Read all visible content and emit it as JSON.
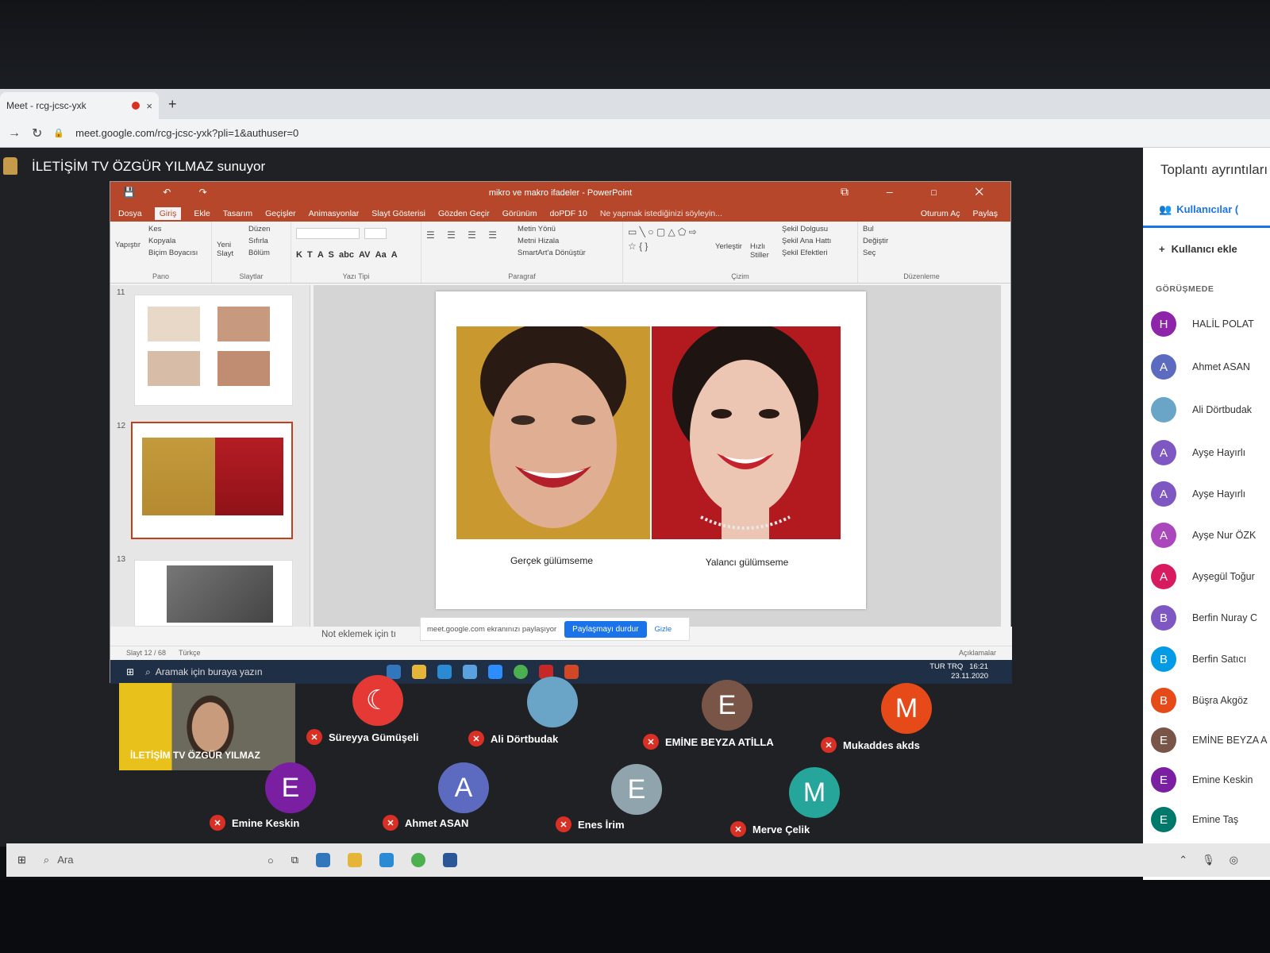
{
  "browser": {
    "tab_title": "Meet - rcg-jcsc-yxk",
    "tab_close": "×",
    "new_tab": "+",
    "url": "meet.google.com/rcg-jcsc-yxk?pli=1&authuser=0"
  },
  "meet": {
    "presenter_banner": "İLETİŞİM TV ÖZGÜR YILMAZ sunuyor",
    "share_notice": "meet.google.com ekranınızı paylaşıyor",
    "stop_sharing": "Paylaşmayı durdur",
    "hide": "Gizle"
  },
  "powerpoint": {
    "doc_title": "mikro ve makro ifadeler - PowerPoint",
    "menu": [
      "Dosya",
      "Giriş",
      "Ekle",
      "Tasarım",
      "Geçişler",
      "Animasyonlar",
      "Slayt Gösterisi",
      "Gözden Geçir",
      "Görünüm",
      "doPDF 10"
    ],
    "tell_me": "Ne yapmak istediğinizi söyleyin...",
    "sign_in": "Oturum Aç",
    "share": "Paylaş",
    "ribbon": {
      "clipboard": [
        "Kes",
        "Kopyala",
        "Biçim Boyacısı"
      ],
      "paste": "Yapıştır",
      "clipboard_group": "Pano",
      "slides": [
        "Düzen",
        "Sıfırla",
        "Bölüm"
      ],
      "new_slide": "Yeni Slayt",
      "slides_group": "Slaytlar",
      "font_group": "Yazı Tipi",
      "paragraph": [
        "Metin Yönü",
        "Metni Hizala",
        "SmartArt'a Dönüştür"
      ],
      "paragraph_group": "Paragraf",
      "arrange": "Yerleştir",
      "quick_styles": "Hızlı Stiller",
      "drawing": [
        "Şekil Dolgusu",
        "Şekil Ana Hattı",
        "Şekil Efektleri"
      ],
      "drawing_group": "Çizim",
      "editing": [
        "Bul",
        "Değiştir",
        "Seç"
      ],
      "editing_group": "Düzenleme"
    },
    "slide_numbers": [
      "11",
      "12",
      "13"
    ],
    "captions": {
      "left": "Gerçek gülümseme",
      "right": "Yalancı gülümseme"
    },
    "notes_placeholder": "Not eklemek için tı",
    "status": {
      "slide": "Slayt 12 / 68",
      "lang": "Türkçe",
      "comments": "Açıklamalar"
    },
    "taskbar": {
      "search": "Aramak için buraya yazın",
      "lang": "TUR TRQ",
      "time": "16:21",
      "date": "23.11.2020"
    }
  },
  "tiles": {
    "self_name": "İLETİŞİM TV ÖZGÜR YILMAZ",
    "participants": [
      {
        "name": "Süreyya Gümüşeli",
        "initial": "",
        "color": "#e53935"
      },
      {
        "name": "Ali Dörtbudak",
        "initial": "",
        "color": "#6aa5c7"
      },
      {
        "name": "EMİNE BEYZA ATİLLA",
        "initial": "E",
        "color": "#795548"
      },
      {
        "name": "Mukaddes akds",
        "initial": "M",
        "color": "#e64a19"
      },
      {
        "name": "Emine Keskin",
        "initial": "E",
        "color": "#7b1fa2"
      },
      {
        "name": "Ahmet ASAN",
        "initial": "A",
        "color": "#5c6bc0"
      },
      {
        "name": "Enes İrim",
        "initial": "E",
        "color": "#90a4ae"
      },
      {
        "name": "Merve Çelik",
        "initial": "M",
        "color": "#26a69a"
      }
    ]
  },
  "panel": {
    "title": "Toplantı ayrıntıları",
    "tab_people": "Kullanıcılar (",
    "add_people": "Kullanıcı ekle",
    "section": "GÖRÜŞMEDE",
    "people": [
      {
        "name": "HALİL POLAT",
        "initial": "H",
        "color": "#8e24aa"
      },
      {
        "name": "Ahmet ASAN",
        "initial": "A",
        "color": "#5c6bc0"
      },
      {
        "name": "Ali Dörtbudak",
        "initial": "",
        "color": "#6aa5c7"
      },
      {
        "name": "Ayşe Hayırlı",
        "initial": "A",
        "color": "#7e57c2"
      },
      {
        "name": "Ayşe Hayırlı",
        "initial": "A",
        "color": "#7e57c2"
      },
      {
        "name": "Ayşe Nur ÖZK",
        "initial": "A",
        "color": "#ab47bc"
      },
      {
        "name": "Ayşegül Toğur",
        "initial": "A",
        "color": "#d81b60"
      },
      {
        "name": "Berfin Nuray C",
        "initial": "B",
        "color": "#7e57c2"
      },
      {
        "name": "Berfin Satıcı",
        "initial": "B",
        "color": "#039be5"
      },
      {
        "name": "Büşra Akgöz",
        "initial": "B",
        "color": "#e64a19"
      },
      {
        "name": "EMİNE BEYZA A",
        "initial": "E",
        "color": "#795548"
      },
      {
        "name": "Emine Keskin",
        "initial": "E",
        "color": "#7b1fa2"
      },
      {
        "name": "Emine Taş",
        "initial": "E",
        "color": "#00796b"
      }
    ]
  },
  "os_taskbar": {
    "search": "Ara"
  }
}
